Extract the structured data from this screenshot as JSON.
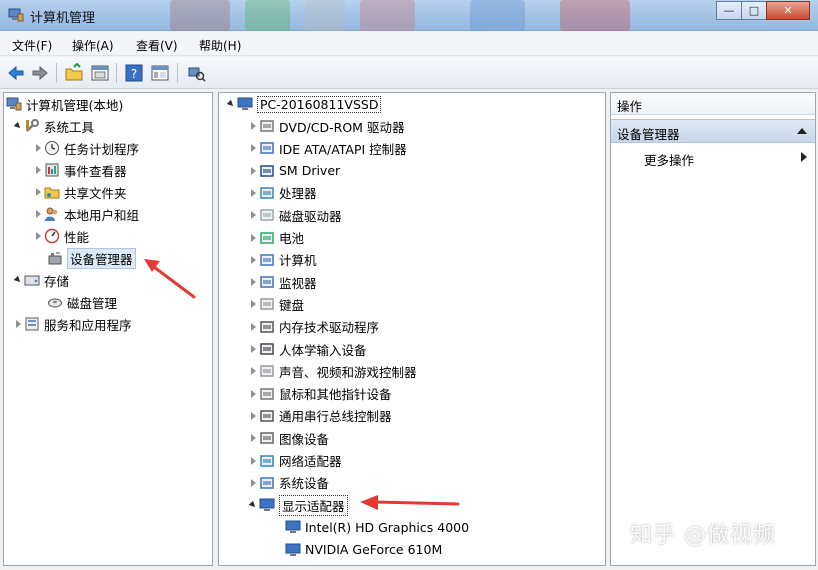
{
  "window": {
    "title": "计算机管理",
    "buttons": {
      "minimize": "—",
      "maximize": "□",
      "close": "✕"
    }
  },
  "menu": [
    {
      "label": "文件(F)"
    },
    {
      "label": "操作(A)"
    },
    {
      "label": "查看(V)"
    },
    {
      "label": "帮助(H)"
    }
  ],
  "toolbar": {
    "icons": [
      "back-icon",
      "forward-icon",
      "up-folder-icon",
      "properties-icon",
      "help-icon",
      "show-hide-icon",
      "scan-hardware-icon"
    ]
  },
  "left_tree": {
    "root": "计算机管理(本地)",
    "system_tools": "系统工具",
    "items": [
      {
        "label": "任务计划程序"
      },
      {
        "label": "事件查看器"
      },
      {
        "label": "共享文件夹"
      },
      {
        "label": "本地用户和组"
      },
      {
        "label": "性能"
      },
      {
        "label": "设备管理器"
      }
    ],
    "storage": "存储",
    "disk_management": "磁盘管理",
    "services": "服务和应用程序"
  },
  "device_tree": {
    "computer": "PC-20160811VSSD",
    "categories": [
      {
        "label": "DVD/CD-ROM 驱动器"
      },
      {
        "label": "IDE ATA/ATAPI 控制器"
      },
      {
        "label": "SM Driver"
      },
      {
        "label": "处理器"
      },
      {
        "label": "磁盘驱动器"
      },
      {
        "label": "电池"
      },
      {
        "label": "计算机"
      },
      {
        "label": "监视器"
      },
      {
        "label": "键盘"
      },
      {
        "label": "内存技术驱动程序"
      },
      {
        "label": "人体学输入设备"
      },
      {
        "label": "声音、视频和游戏控制器"
      },
      {
        "label": "鼠标和其他指针设备"
      },
      {
        "label": "通用串行总线控制器"
      },
      {
        "label": "图像设备"
      },
      {
        "label": "网络适配器"
      },
      {
        "label": "系统设备"
      }
    ],
    "display": "显示适配器",
    "display_children": [
      {
        "label": "Intel(R) HD Graphics 4000"
      },
      {
        "label": "NVIDIA GeForce 610M"
      }
    ]
  },
  "actions": {
    "header": "操作",
    "section": "设备管理器",
    "more": "更多操作"
  },
  "watermark": "知乎 @做视频",
  "colors": {
    "selection": "#dceaf7",
    "annotation": "#e53935",
    "titlebar": "#a5c4e6"
  }
}
